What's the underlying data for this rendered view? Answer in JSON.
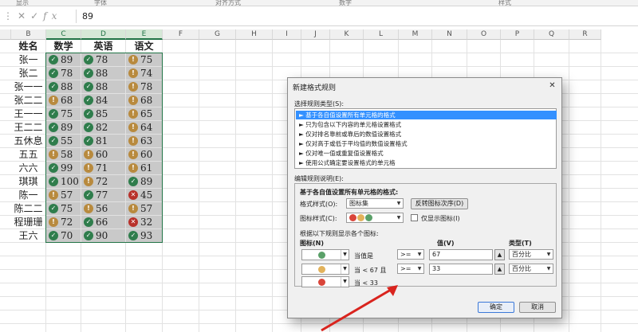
{
  "ribbon": {
    "sections": [
      "显示",
      "字体",
      "对齐方式",
      "数字",
      "样式"
    ]
  },
  "formula_bar": {
    "value": "89",
    "icons": [
      "close-icon",
      "check-icon",
      "fx-icon"
    ]
  },
  "columns": [
    "B",
    "C",
    "D",
    "E",
    "F",
    "G",
    "H",
    "I",
    "J",
    "K",
    "L",
    "M",
    "N",
    "O",
    "P",
    "Q",
    "R"
  ],
  "table": {
    "headers": [
      "姓名",
      "数学",
      "英语",
      "语文"
    ],
    "rows": [
      {
        "name": "张一",
        "math": "89",
        "math_icon": "g",
        "eng": "78",
        "eng_icon": "g",
        "chn": "75",
        "chn_icon": "y"
      },
      {
        "name": "张二",
        "math": "78",
        "math_icon": "g",
        "eng": "88",
        "eng_icon": "g",
        "chn": "74",
        "chn_icon": "y"
      },
      {
        "name": "张一一",
        "math": "88",
        "math_icon": "g",
        "eng": "88",
        "eng_icon": "g",
        "chn": "78",
        "chn_icon": "y"
      },
      {
        "name": "张二二",
        "math": "68",
        "math_icon": "y",
        "eng": "84",
        "eng_icon": "g",
        "chn": "68",
        "chn_icon": "y"
      },
      {
        "name": "王一一",
        "math": "75",
        "math_icon": "g",
        "eng": "85",
        "eng_icon": "g",
        "chn": "65",
        "chn_icon": "y"
      },
      {
        "name": "王二二",
        "math": "89",
        "math_icon": "g",
        "eng": "82",
        "eng_icon": "g",
        "chn": "64",
        "chn_icon": "y"
      },
      {
        "name": "五休息",
        "math": "55",
        "math_icon": "g",
        "eng": "81",
        "eng_icon": "g",
        "chn": "63",
        "chn_icon": "y"
      },
      {
        "name": "五五",
        "math": "58",
        "math_icon": "y",
        "eng": "60",
        "eng_icon": "y",
        "chn": "60",
        "chn_icon": "y"
      },
      {
        "name": "六六",
        "math": "99",
        "math_icon": "g",
        "eng": "71",
        "eng_icon": "y",
        "chn": "61",
        "chn_icon": "y"
      },
      {
        "name": "琪琪",
        "math": "100",
        "math_icon": "g",
        "eng": "72",
        "eng_icon": "y",
        "chn": "89",
        "chn_icon": "g"
      },
      {
        "name": "陈一",
        "math": "57",
        "math_icon": "y",
        "eng": "77",
        "eng_icon": "g",
        "chn": "45",
        "chn_icon": "r"
      },
      {
        "name": "陈二二",
        "math": "75",
        "math_icon": "g",
        "eng": "56",
        "eng_icon": "y",
        "chn": "57",
        "chn_icon": "y"
      },
      {
        "name": "程珊珊",
        "math": "72",
        "math_icon": "y",
        "eng": "66",
        "eng_icon": "g",
        "chn": "32",
        "chn_icon": "r"
      },
      {
        "name": "王六",
        "math": "70",
        "math_icon": "g",
        "eng": "90",
        "eng_icon": "g",
        "chn": "93",
        "chn_icon": "g"
      }
    ]
  },
  "dialog": {
    "title": "新建格式规则",
    "select_rule_label": "选择规则类型(S):",
    "rule_types": [
      "► 基于各自值设置所有单元格的格式",
      "► 只为包含以下内容的单元格设置格式",
      "► 仅对排名靠前或靠后的数值设置格式",
      "► 仅对高于或低于平均值的数值设置格式",
      "► 仅对唯一值或重复值设置格式",
      "► 使用公式确定要设置格式的单元格"
    ],
    "edit_label": "编辑规则说明(E):",
    "group_title": "基于各自值设置所有单元格的格式:",
    "format_style_label": "格式样式(O):",
    "format_style_value": "图标集",
    "reverse_button": "反转图标次序(D)",
    "icon_style_label": "图标样式(C):",
    "show_icon_only": "仅显示图标(I)",
    "rules_caption": "根据以下规则显示各个图标:",
    "icon_col": "图标(N)",
    "value_col": "值(V)",
    "type_col": "类型(T)",
    "rows": [
      {
        "icon": "g",
        "cond": "当值是",
        "op": ">=",
        "value": "67",
        "type": "百分比"
      },
      {
        "icon": "y",
        "cond": "当 < 67 且",
        "op": ">=",
        "value": "33",
        "type": "百分比"
      },
      {
        "icon": "r",
        "cond": "当 < 33",
        "op": "",
        "value": "",
        "type": ""
      }
    ],
    "ok": "确定",
    "cancel": "取消"
  }
}
